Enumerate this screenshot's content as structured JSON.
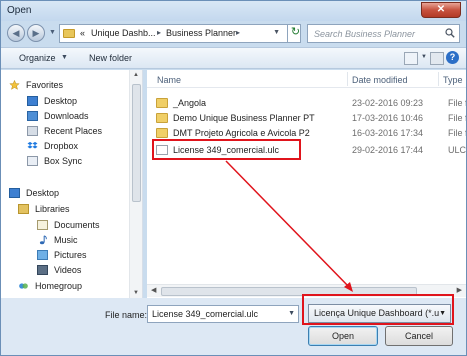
{
  "window": {
    "title": "Open",
    "close_glyph": "✕"
  },
  "navigation": {
    "back_glyph": "◀",
    "forward_glyph": "▶",
    "history_glyph": "▼",
    "breadcrumb": [
      "«",
      "Unique Dashb...",
      "Business Planner"
    ],
    "breadcrumb_separators": [
      "▸",
      "▸"
    ],
    "refresh_glyph": "↻",
    "search_placeholder": "Search Business Planner"
  },
  "toolbar": {
    "organize_label": "Organize",
    "organize_caret": "▼",
    "new_folder_label": "New folder",
    "help_glyph": "?"
  },
  "sidebar": {
    "favorites_header": "Favorites",
    "favorites": [
      "Desktop",
      "Downloads",
      "Recent Places",
      "Dropbox",
      "Box Sync"
    ],
    "desktop_header": "Desktop",
    "libraries_header": "Libraries",
    "libraries": [
      "Documents",
      "Music",
      "Pictures",
      "Videos"
    ],
    "homegroup": "Homegroup"
  },
  "columns": {
    "name": "Name",
    "date_modified": "Date modified",
    "type": "Type"
  },
  "files": [
    {
      "name": "_Angola",
      "date": "23-02-2016 09:23",
      "type": "File fo",
      "kind": "folder"
    },
    {
      "name": "Demo Unique Business Planner PT",
      "date": "17-03-2016 10:46",
      "type": "File fo",
      "kind": "folder"
    },
    {
      "name": "DMT Projeto Agricola e Avicola P2",
      "date": "16-03-2016 17:34",
      "type": "File fo",
      "kind": "folder"
    },
    {
      "name": "License 349_comercial.ulc",
      "date": "29-02-2016 17:44",
      "type": "ULC Fi",
      "kind": "document"
    }
  ],
  "bottom": {
    "file_name_label": "File name:",
    "file_name_value": "License 349_comercial.ulc",
    "filter_value": "Licença Unique Dashboard (*.u",
    "open_label": "Open",
    "cancel_label": "Cancel"
  },
  "colors": {
    "annotation": "#e0141c",
    "accent": "#2c6fc7",
    "folder": "#f0cf67"
  }
}
